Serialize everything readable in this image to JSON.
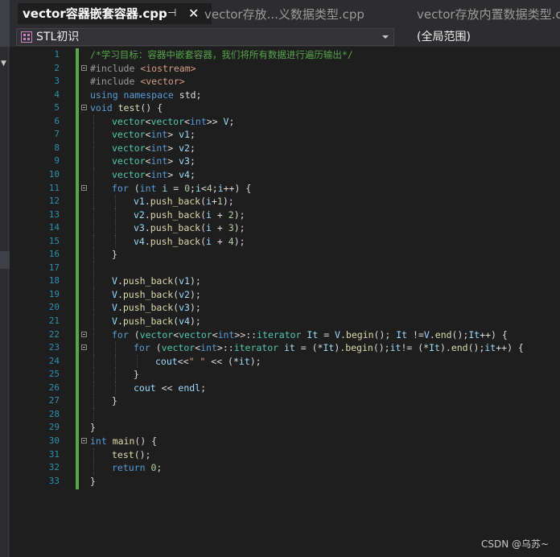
{
  "tabs": [
    {
      "label": "vector容器嵌套容器.cpp",
      "active": true,
      "pin_icon": "pin-icon",
      "close_icon": "close-icon"
    },
    {
      "label": "vector存放...义数据类型.cpp",
      "active": false
    },
    {
      "label": "vector存放内置数据类型.c",
      "active": false
    }
  ],
  "navbar": {
    "project": "STL初识",
    "scope": "(全局范围)"
  },
  "colors": {
    "background": "#1e1e1e",
    "keyword": "#569cd6",
    "type": "#4ec9b0",
    "comment": "#57a64a",
    "line_number": "#2b91af",
    "change_bar": "#57a64a"
  },
  "editor": {
    "lines": [
      {
        "n": "1",
        "t": [
          [
            "cm",
            "/*学习目标：容器中嵌套容器，我们将所有数据进行遍历输出*/"
          ]
        ],
        "indent": 1
      },
      {
        "n": "2",
        "t": [
          [
            "pp",
            "#include "
          ],
          [
            "inc",
            "<iostream>"
          ]
        ],
        "indent": 1
      },
      {
        "n": "3",
        "t": [
          [
            "pp",
            "#include "
          ],
          [
            "inc",
            "<vector>"
          ]
        ],
        "indent": 1
      },
      {
        "n": "4",
        "t": [
          [
            "kw",
            "using namespace "
          ],
          [
            "pl",
            "std;"
          ]
        ],
        "indent": 0
      },
      {
        "n": "5",
        "t": [
          [
            "kw",
            "void "
          ],
          [
            "fn",
            "test"
          ],
          [
            "pl",
            "() {"
          ]
        ],
        "indent": 0
      },
      {
        "n": "6",
        "t": [
          [
            "ty",
            "vector"
          ],
          [
            "pl",
            "<"
          ],
          [
            "ty",
            "vector"
          ],
          [
            "pl",
            "<"
          ],
          [
            "kw",
            "int"
          ],
          [
            "pl",
            ">> "
          ],
          [
            "var",
            "V"
          ],
          [
            "pl",
            ";"
          ]
        ],
        "indent": 2
      },
      {
        "n": "7",
        "t": [
          [
            "ty",
            "vector"
          ],
          [
            "pl",
            "<"
          ],
          [
            "kw",
            "int"
          ],
          [
            "pl",
            "> "
          ],
          [
            "var",
            "v1"
          ],
          [
            "pl",
            ";"
          ]
        ],
        "indent": 2
      },
      {
        "n": "8",
        "t": [
          [
            "ty",
            "vector"
          ],
          [
            "pl",
            "<"
          ],
          [
            "kw",
            "int"
          ],
          [
            "pl",
            "> "
          ],
          [
            "var",
            "v2"
          ],
          [
            "pl",
            ";"
          ]
        ],
        "indent": 2
      },
      {
        "n": "9",
        "t": [
          [
            "ty",
            "vector"
          ],
          [
            "pl",
            "<"
          ],
          [
            "kw",
            "int"
          ],
          [
            "pl",
            "> "
          ],
          [
            "var",
            "v3"
          ],
          [
            "pl",
            ";"
          ]
        ],
        "indent": 2
      },
      {
        "n": "10",
        "t": [
          [
            "ty",
            "vector"
          ],
          [
            "pl",
            "<"
          ],
          [
            "kw",
            "int"
          ],
          [
            "pl",
            "> "
          ],
          [
            "var",
            "v4"
          ],
          [
            "pl",
            ";"
          ]
        ],
        "indent": 2
      },
      {
        "n": "11",
        "t": [
          [
            "kw",
            "for "
          ],
          [
            "pl",
            "("
          ],
          [
            "kw",
            "int "
          ],
          [
            "var",
            "i"
          ],
          [
            "pl",
            " = "
          ],
          [
            "num",
            "0"
          ],
          [
            "pl",
            ";"
          ],
          [
            "var",
            "i"
          ],
          [
            "pl",
            "<"
          ],
          [
            "num",
            "4"
          ],
          [
            "pl",
            ";"
          ],
          [
            "var",
            "i"
          ],
          [
            "pl",
            "++) {"
          ]
        ],
        "indent": 2
      },
      {
        "n": "12",
        "t": [
          [
            "var",
            "v1"
          ],
          [
            "pl",
            "."
          ],
          [
            "fn",
            "push_back"
          ],
          [
            "pl",
            "("
          ],
          [
            "var",
            "i"
          ],
          [
            "pl",
            "+"
          ],
          [
            "num",
            "1"
          ],
          [
            "pl",
            ");"
          ]
        ],
        "indent": 3
      },
      {
        "n": "13",
        "t": [
          [
            "var",
            "v2"
          ],
          [
            "pl",
            "."
          ],
          [
            "fn",
            "push_back"
          ],
          [
            "pl",
            "("
          ],
          [
            "var",
            "i"
          ],
          [
            "pl",
            " + "
          ],
          [
            "num",
            "2"
          ],
          [
            "pl",
            ");"
          ]
        ],
        "indent": 3
      },
      {
        "n": "14",
        "t": [
          [
            "var",
            "v3"
          ],
          [
            "pl",
            "."
          ],
          [
            "fn",
            "push_back"
          ],
          [
            "pl",
            "("
          ],
          [
            "var",
            "i"
          ],
          [
            "pl",
            " + "
          ],
          [
            "num",
            "3"
          ],
          [
            "pl",
            ");"
          ]
        ],
        "indent": 3
      },
      {
        "n": "15",
        "t": [
          [
            "var",
            "v4"
          ],
          [
            "pl",
            "."
          ],
          [
            "fn",
            "push_back"
          ],
          [
            "pl",
            "("
          ],
          [
            "var",
            "i"
          ],
          [
            "pl",
            " + "
          ],
          [
            "num",
            "4"
          ],
          [
            "pl",
            ");"
          ]
        ],
        "indent": 3
      },
      {
        "n": "16",
        "t": [
          [
            "pl",
            "}"
          ]
        ],
        "indent": 2
      },
      {
        "n": "17",
        "t": [],
        "indent": 2
      },
      {
        "n": "18",
        "t": [
          [
            "var",
            "V"
          ],
          [
            "pl",
            "."
          ],
          [
            "fn",
            "push_back"
          ],
          [
            "pl",
            "("
          ],
          [
            "var",
            "v1"
          ],
          [
            "pl",
            ");"
          ]
        ],
        "indent": 2
      },
      {
        "n": "19",
        "t": [
          [
            "var",
            "V"
          ],
          [
            "pl",
            "."
          ],
          [
            "fn",
            "push_back"
          ],
          [
            "pl",
            "("
          ],
          [
            "var",
            "v2"
          ],
          [
            "pl",
            ");"
          ]
        ],
        "indent": 2
      },
      {
        "n": "20",
        "t": [
          [
            "var",
            "V"
          ],
          [
            "pl",
            "."
          ],
          [
            "fn",
            "push_back"
          ],
          [
            "pl",
            "("
          ],
          [
            "var",
            "v3"
          ],
          [
            "pl",
            ");"
          ]
        ],
        "indent": 2
      },
      {
        "n": "21",
        "t": [
          [
            "var",
            "V"
          ],
          [
            "pl",
            "."
          ],
          [
            "fn",
            "push_back"
          ],
          [
            "pl",
            "("
          ],
          [
            "var",
            "v4"
          ],
          [
            "pl",
            ");"
          ]
        ],
        "indent": 2
      },
      {
        "n": "22",
        "t": [
          [
            "kw",
            "for "
          ],
          [
            "pl",
            "("
          ],
          [
            "ty",
            "vector"
          ],
          [
            "pl",
            "<"
          ],
          [
            "ty",
            "vector"
          ],
          [
            "pl",
            "<"
          ],
          [
            "kw",
            "int"
          ],
          [
            "pl",
            ">>::"
          ],
          [
            "ty",
            "iterator "
          ],
          [
            "var",
            "It"
          ],
          [
            "pl",
            " = "
          ],
          [
            "var",
            "V"
          ],
          [
            "pl",
            "."
          ],
          [
            "fn",
            "begin"
          ],
          [
            "pl",
            "(); "
          ],
          [
            "var",
            "It"
          ],
          [
            "pl",
            " !="
          ],
          [
            "var",
            "V"
          ],
          [
            "pl",
            "."
          ],
          [
            "fn",
            "end"
          ],
          [
            "pl",
            "();"
          ],
          [
            "var",
            "It"
          ],
          [
            "pl",
            "++) {"
          ]
        ],
        "indent": 2
      },
      {
        "n": "23",
        "t": [
          [
            "kw",
            "for "
          ],
          [
            "pl",
            "("
          ],
          [
            "ty",
            "vector"
          ],
          [
            "pl",
            "<"
          ],
          [
            "kw",
            "int"
          ],
          [
            "pl",
            ">::"
          ],
          [
            "ty",
            "iterator "
          ],
          [
            "var",
            "it"
          ],
          [
            "pl",
            " = (*"
          ],
          [
            "var",
            "It"
          ],
          [
            "pl",
            ")."
          ],
          [
            "fn",
            "begin"
          ],
          [
            "pl",
            "();"
          ],
          [
            "var",
            "it"
          ],
          [
            "pl",
            "!= (*"
          ],
          [
            "var",
            "It"
          ],
          [
            "pl",
            ")."
          ],
          [
            "fn",
            "end"
          ],
          [
            "pl",
            "();"
          ],
          [
            "var",
            "it"
          ],
          [
            "pl",
            "++) {"
          ]
        ],
        "indent": 3
      },
      {
        "n": "24",
        "t": [
          [
            "var",
            "cout"
          ],
          [
            "pl",
            "<<"
          ],
          [
            "str",
            "\" \""
          ],
          [
            "pl",
            " << (*"
          ],
          [
            "var",
            "it"
          ],
          [
            "pl",
            ");"
          ]
        ],
        "indent": 4
      },
      {
        "n": "25",
        "t": [
          [
            "pl",
            "}"
          ]
        ],
        "indent": 3
      },
      {
        "n": "26",
        "t": [
          [
            "var",
            "cout"
          ],
          [
            "pl",
            " << "
          ],
          [
            "var",
            "endl"
          ],
          [
            "pl",
            ";"
          ]
        ],
        "indent": 3
      },
      {
        "n": "27",
        "t": [
          [
            "pl",
            "}"
          ]
        ],
        "indent": 2
      },
      {
        "n": "28",
        "t": [],
        "indent": 2
      },
      {
        "n": "29",
        "t": [
          [
            "pl",
            "}"
          ]
        ],
        "indent": 0
      },
      {
        "n": "30",
        "t": [
          [
            "kw",
            "int "
          ],
          [
            "fn",
            "main"
          ],
          [
            "pl",
            "() {"
          ]
        ],
        "indent": 0
      },
      {
        "n": "31",
        "t": [
          [
            "fn",
            "test"
          ],
          [
            "pl",
            "();"
          ]
        ],
        "indent": 2
      },
      {
        "n": "32",
        "t": [
          [
            "kw",
            "return "
          ],
          [
            "num",
            "0"
          ],
          [
            "pl",
            ";"
          ]
        ],
        "indent": 2
      },
      {
        "n": "33",
        "t": [
          [
            "pl",
            "}"
          ]
        ],
        "indent": 0
      }
    ],
    "fold_lines": [
      "2",
      "5",
      "11",
      "22",
      "23",
      "30"
    ]
  },
  "watermark": "CSDN @乌苏~"
}
